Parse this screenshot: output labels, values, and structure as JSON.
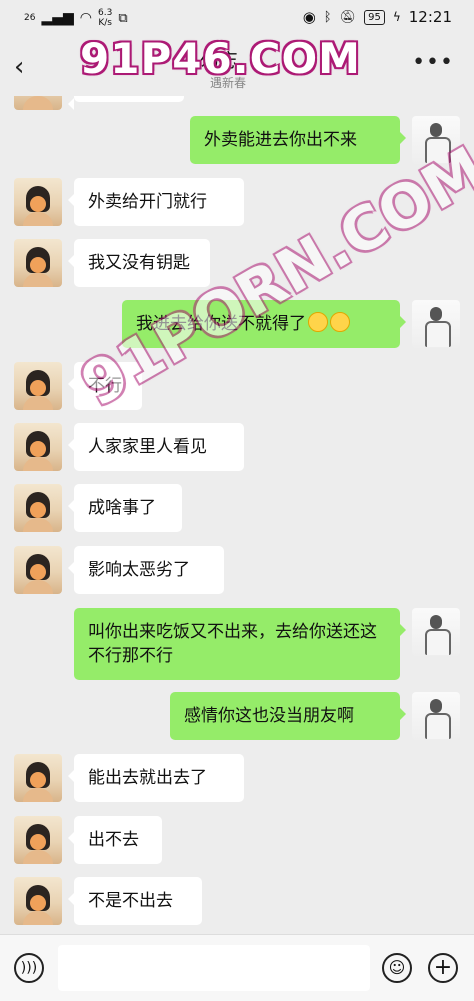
{
  "status": {
    "signal": "26",
    "net_speed": "6.3\nK/s",
    "battery": "95",
    "time": "12:21"
  },
  "header": {
    "title": "勿忘",
    "subtitle": "遇新春",
    "back_icon": "chevron-left-icon",
    "more_icon": "more-dots-icon"
  },
  "messages": [
    {
      "side": "out",
      "text": "外卖能进去你出不来"
    },
    {
      "side": "in",
      "text": "外卖给开门就行"
    },
    {
      "side": "in",
      "text": "我又没有钥匙"
    },
    {
      "side": "out",
      "text": "我进去给你送不就得了"
    },
    {
      "side": "in",
      "text": "不行"
    },
    {
      "side": "in",
      "text": "人家家里人看见"
    },
    {
      "side": "in",
      "text": "成啥事了"
    },
    {
      "side": "in",
      "text": "影响太恶劣了"
    },
    {
      "side": "out",
      "text": "叫你出来吃饭又不出来，去给你送还这不行那不行"
    },
    {
      "side": "out",
      "text": "感情你这也没当朋友啊"
    },
    {
      "side": "in",
      "text": "能出去就出去了"
    },
    {
      "side": "in",
      "text": "出不去"
    },
    {
      "side": "in",
      "text": "不是不出去"
    }
  ],
  "watermark": {
    "top": "91P46.COM",
    "diagonal": "91PORN.COM"
  },
  "input": {
    "placeholder": ""
  }
}
